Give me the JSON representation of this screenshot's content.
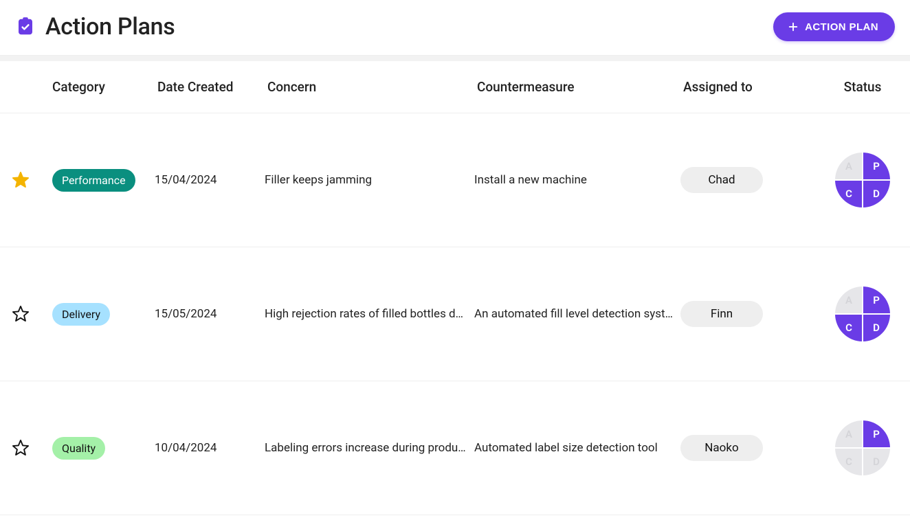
{
  "header": {
    "title": "Action Plans",
    "new_button_label": "ACTION PLAN"
  },
  "columns": {
    "category": "Category",
    "date_created": "Date Created",
    "concern": "Concern",
    "countermeasure": "Countermeasure",
    "assigned_to": "Assigned to",
    "status": "Status"
  },
  "colors": {
    "accent": "#6a3ce6",
    "pill_performance": "#0a8f7f",
    "pill_delivery": "#a6e1ff",
    "pill_quality": "#a4f0a8",
    "chip_bg": "#eee"
  },
  "rows": [
    {
      "starred": true,
      "category": "Performance",
      "category_style": "pill-performance",
      "date": "15/04/2024",
      "concern": "Filler keeps jamming",
      "countermeasure": "Install a new machine",
      "assignee": "Chad",
      "pdca": {
        "A": false,
        "P": true,
        "C": true,
        "D": true
      }
    },
    {
      "starred": false,
      "category": "Delivery",
      "category_style": "pill-delivery",
      "date": "15/05/2024",
      "concern": "High rejection rates of filled bottles due…",
      "countermeasure": "An automated fill level detection syst…",
      "assignee": "Finn",
      "pdca": {
        "A": false,
        "P": true,
        "C": true,
        "D": true
      }
    },
    {
      "starred": false,
      "category": "Quality",
      "category_style": "pill-quality",
      "date": "10/04/2024",
      "concern": "Labeling errors increase during product…",
      "countermeasure": "Automated label size detection tool",
      "assignee": "Naoko",
      "pdca": {
        "A": false,
        "P": true,
        "C": false,
        "D": false
      }
    }
  ]
}
